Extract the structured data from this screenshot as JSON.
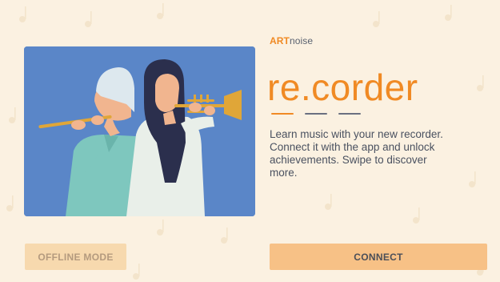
{
  "brand": {
    "art": "ART",
    "noise": "noise"
  },
  "title": "re.corder",
  "description": "Learn music with your new recorder. Connect it with the app and unlock achievements. Swipe to discover more.",
  "pager": {
    "count": 3,
    "active_index": 0
  },
  "buttons": {
    "offline_label": "OFFLINE MODE",
    "connect_label": "CONNECT"
  },
  "colors": {
    "accent": "#f08a24",
    "background": "#fbf1e1",
    "illustration_bg": "#5a86c8",
    "connect_button": "#f7c186",
    "offline_button": "#f7d9ae",
    "dash_inactive": "#6a7080"
  }
}
